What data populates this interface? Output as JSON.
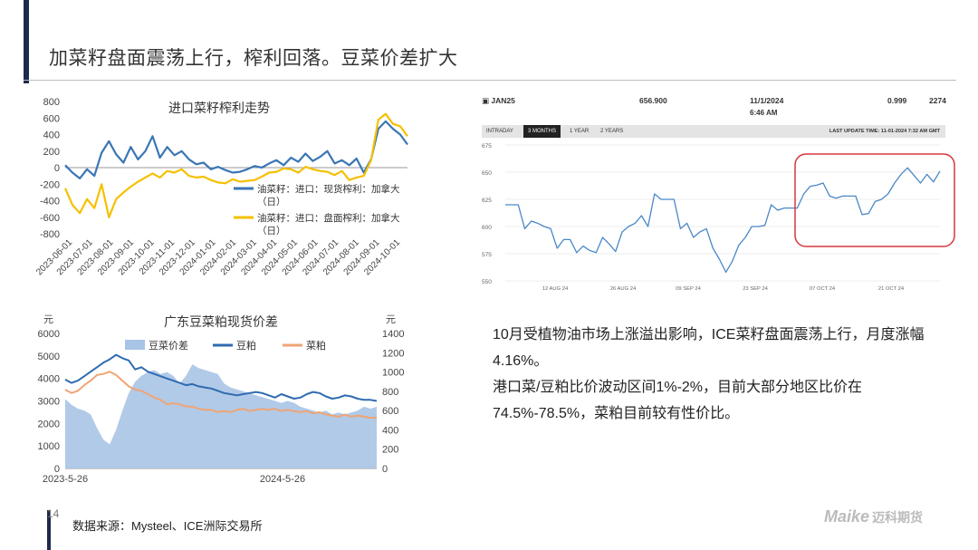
{
  "slide": {
    "title": "加菜籽盘面震荡上行，榨利回落。豆菜价差扩大",
    "page_number": "14",
    "source": "数据来源：Mysteel、ICE洲际交易所",
    "logo_text": "Maike",
    "logo_cn": "迈科期货",
    "body_paragraphs": [
      "10月受植物油市场上涨溢出影响，ICE菜籽盘面震荡上行，月度涨幅4.16%。",
      "港口菜/豆粕比价波动区间1%-2%，目前大部分地区比价在74.5%-78.5%，菜粕目前较有性价比。"
    ],
    "colors": {
      "accent_bar": "#1d2a4d",
      "highlight_box": "#d9363e"
    }
  },
  "chart_data": [
    {
      "type": "line",
      "title": "进口菜籽榨利走势",
      "yticks": [
        800,
        600,
        400,
        200,
        0,
        -200,
        -400,
        -600,
        -800
      ],
      "ylim": [
        -800,
        800
      ],
      "xticks": [
        "2023-06-01",
        "2023-07-01",
        "2023-08-01",
        "2023-09-01",
        "2023-10-01",
        "2023-11-01",
        "2023-12-01",
        "2024-01-01",
        "2024-02-01",
        "2024-03-01",
        "2024-04-01",
        "2024-05-01",
        "2024-06-01",
        "2024-07-01",
        "2024-08-01",
        "2024-09-01",
        "2024-10-01"
      ],
      "legend_position": "right",
      "series": [
        {
          "name": "油菜籽：进口：现货榨利：加拿大（日）",
          "color": "#3a76b4",
          "values": [
            30,
            -60,
            -130,
            -20,
            -100,
            180,
            320,
            160,
            60,
            250,
            100,
            200,
            380,
            120,
            250,
            150,
            200,
            100,
            40,
            60,
            -20,
            10,
            -30,
            -60,
            -50,
            -20,
            20,
            0,
            50,
            90,
            30,
            120,
            70,
            170,
            80,
            130,
            200,
            50,
            90,
            30,
            110,
            -60,
            100,
            470,
            560,
            470,
            400,
            280
          ]
        },
        {
          "name": "油菜籽：进口：盘面榨利：加拿大（日）",
          "color": "#f5c000",
          "values": [
            -250,
            -450,
            -550,
            -380,
            -490,
            -200,
            -600,
            -380,
            -300,
            -230,
            -170,
            -120,
            -70,
            -120,
            -40,
            -60,
            -20,
            -100,
            -120,
            -110,
            -150,
            -180,
            -190,
            -140,
            -170,
            -160,
            -150,
            -110,
            -60,
            -50,
            -10,
            -20,
            -60,
            10,
            -20,
            -40,
            -50,
            -90,
            -40,
            -150,
            -120,
            -100,
            90,
            580,
            650,
            530,
            500,
            380
          ]
        }
      ]
    },
    {
      "type": "area",
      "title": "广东豆菜粕现货价差",
      "ylabel_left": "元",
      "ylabel_right": "元",
      "yticks_left": [
        6000,
        5000,
        4000,
        3000,
        2000,
        1000,
        0
      ],
      "yticks_right": [
        1400,
        1200,
        1000,
        800,
        600,
        400,
        200,
        0
      ],
      "ylim_left": [
        0,
        6000
      ],
      "ylim_right": [
        0,
        1400
      ],
      "xticks": [
        "2023-5-26",
        "2024-5-26"
      ],
      "legend_position": "top",
      "series": [
        {
          "name": "豆菜价差",
          "axis": "right",
          "kind": "area",
          "color": "#a8c4e6",
          "values": [
            720,
            660,
            620,
            600,
            560,
            420,
            300,
            250,
            400,
            600,
            780,
            900,
            960,
            1000,
            1020,
            980,
            1000,
            960,
            880,
            960,
            1080,
            1040,
            1020,
            1000,
            980,
            880,
            840,
            820,
            800,
            780,
            760,
            740,
            720,
            700,
            680,
            700,
            680,
            640,
            620,
            600,
            580,
            600,
            560,
            580,
            560,
            580,
            600,
            640,
            620,
            640
          ]
        },
        {
          "name": "豆粕",
          "axis": "left",
          "kind": "line",
          "color": "#2f6bb0",
          "values": [
            3950,
            3800,
            3900,
            4100,
            4300,
            4500,
            4700,
            4850,
            5050,
            4900,
            4800,
            4400,
            4500,
            4300,
            4200,
            4100,
            4000,
            3900,
            3800,
            3700,
            3750,
            3650,
            3600,
            3550,
            3450,
            3350,
            3300,
            3250,
            3300,
            3350,
            3400,
            3350,
            3250,
            3150,
            3300,
            3200,
            3100,
            3150,
            3300,
            3400,
            3350,
            3200,
            3100,
            3150,
            3250,
            3200,
            3100,
            3050,
            3050,
            3000
          ]
        },
        {
          "name": "菜粕",
          "axis": "left",
          "kind": "line",
          "color": "#f0a474",
          "values": [
            3500,
            3350,
            3450,
            3700,
            3900,
            4150,
            4200,
            4300,
            4150,
            3900,
            3650,
            3500,
            3450,
            3300,
            3150,
            3050,
            2850,
            2900,
            2850,
            2750,
            2750,
            2650,
            2600,
            2600,
            2500,
            2550,
            2500,
            2600,
            2650,
            2550,
            2600,
            2650,
            2600,
            2650,
            2550,
            2600,
            2550,
            2500,
            2550,
            2450,
            2500,
            2400,
            2350,
            2300,
            2400,
            2300,
            2350,
            2300,
            2250,
            2250
          ]
        }
      ]
    },
    {
      "type": "line",
      "header": {
        "symbol": "JAN25",
        "price": "656.900",
        "date": "11/1/2024",
        "time": "6:46 AM",
        "change": "0.999",
        "volume": "2274"
      },
      "tabs": [
        "INTRADAY",
        "3 MONTHS",
        "1 YEAR",
        "2 YEARS"
      ],
      "active_tab": "3 MONTHS",
      "last_update": "LAST UPDATE TIME: 11-01-2024 7:32 AM GMT",
      "yticks": [
        675,
        650,
        625,
        600,
        575,
        550
      ],
      "ylim": [
        550,
        675
      ],
      "xticks": [
        "12 AUG 24",
        "26 AUG 24",
        "09 SEP 24",
        "23 SEP 24",
        "07 OCT 24",
        "21 OCT 24"
      ],
      "highlight": "07 OCT 24 — 21 OCT 24",
      "series": [
        {
          "name": "",
          "color": "#4a88c8",
          "values": [
            620,
            620,
            620,
            598,
            605,
            603,
            600,
            598,
            580,
            588,
            588,
            576,
            582,
            578,
            576,
            590,
            584,
            577,
            595,
            600,
            603,
            610,
            600,
            630,
            625,
            625,
            625,
            598,
            603,
            590,
            595,
            598,
            580,
            570,
            558,
            568,
            583,
            590,
            600,
            600,
            601,
            620,
            615,
            617,
            617,
            617,
            630,
            637,
            638,
            640,
            628,
            626,
            628,
            628,
            628,
            611,
            612,
            623,
            625,
            630,
            640,
            648,
            654,
            647,
            640,
            648,
            641,
            651
          ]
        }
      ]
    }
  ]
}
